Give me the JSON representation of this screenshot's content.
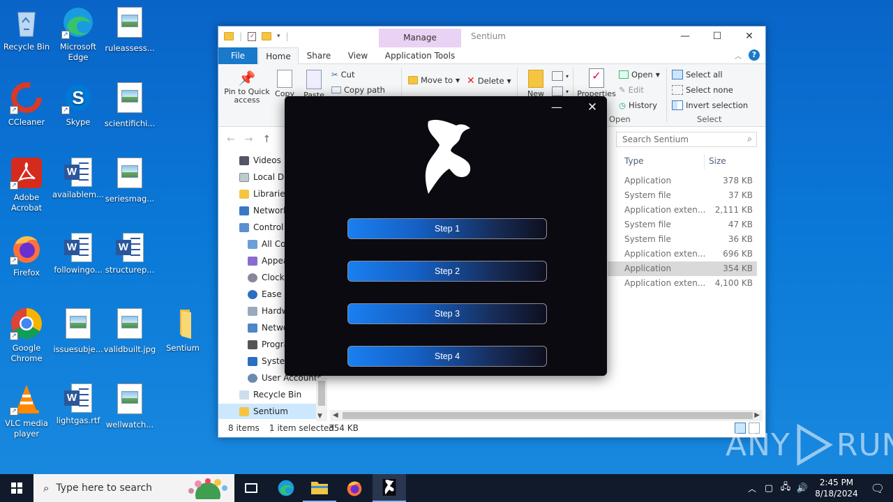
{
  "desktop": {
    "icons": [
      {
        "label": "Recycle Bin",
        "icon": "recycle-bin-icon"
      },
      {
        "label": "Microsoft Edge",
        "icon": "edge-icon"
      },
      {
        "label": "ruleassess...",
        "icon": "image-file-icon"
      },
      {
        "label": "CCleaner",
        "icon": "ccleaner-icon"
      },
      {
        "label": "Skype",
        "icon": "skype-icon"
      },
      {
        "label": "scientifichi...",
        "icon": "image-file-icon"
      },
      {
        "label": "Adobe Acrobat",
        "icon": "acrobat-icon"
      },
      {
        "label": "availablem...",
        "icon": "word-doc-icon"
      },
      {
        "label": "seriesmag...",
        "icon": "image-file-icon"
      },
      {
        "label": "Firefox",
        "icon": "firefox-icon"
      },
      {
        "label": "followingo...",
        "icon": "word-doc-icon"
      },
      {
        "label": "structurep...",
        "icon": "word-doc-icon"
      },
      {
        "label": "Google Chrome",
        "icon": "chrome-icon"
      },
      {
        "label": "issuesubje...",
        "icon": "image-file-icon"
      },
      {
        "label": "validbuilt.jpg",
        "icon": "image-file-icon"
      },
      {
        "label": "Sentium",
        "icon": "folder-icon"
      },
      {
        "label": "VLC media player",
        "icon": "vlc-icon"
      },
      {
        "label": "lightgas.rtf",
        "icon": "word-doc-icon"
      },
      {
        "label": "wellwatch...",
        "icon": "image-file-icon"
      }
    ]
  },
  "explorer": {
    "title": "Sentium",
    "manage_tab": "Manage",
    "tabs": {
      "file": "File",
      "home": "Home",
      "share": "Share",
      "view": "View",
      "app_tools": "Application Tools"
    },
    "ribbon": {
      "pin": "Pin to Quick access",
      "copy": "Copy",
      "paste": "Paste",
      "cut": "Cut",
      "copy_path": "Copy path",
      "move_to": "Move to",
      "delete": "Delete",
      "new": "New",
      "properties": "Properties",
      "open": "Open",
      "edit": "Edit",
      "history": "History",
      "open_group": "Open",
      "select_all": "Select all",
      "select_none": "Select none",
      "invert_selection": "Invert selection",
      "select_group": "Select"
    },
    "search_placeholder": "Search Sentium",
    "nav": [
      {
        "label": "Videos",
        "icon": "videos-icon"
      },
      {
        "label": "Local D",
        "icon": "drive-icon"
      },
      {
        "label": "Libraries",
        "icon": "libraries-icon"
      },
      {
        "label": "Network",
        "icon": "network-icon"
      },
      {
        "label": "Control",
        "icon": "control-panel-icon"
      },
      {
        "label": "All Co",
        "icon": "control-panel-icon"
      },
      {
        "label": "Appea",
        "icon": "appearance-icon"
      },
      {
        "label": "Clock",
        "icon": "clock-icon"
      },
      {
        "label": "Ease o",
        "icon": "ease-of-access-icon"
      },
      {
        "label": "Hardw",
        "icon": "hardware-icon"
      },
      {
        "label": "Netwo",
        "icon": "network-icon"
      },
      {
        "label": "Progra",
        "icon": "programs-icon"
      },
      {
        "label": "System",
        "icon": "system-icon"
      },
      {
        "label": "User Accounts",
        "icon": "user-accounts-icon"
      },
      {
        "label": "Recycle Bin",
        "icon": "recycle-bin-icon"
      },
      {
        "label": "Sentium",
        "icon": "folder-icon"
      }
    ],
    "columns": {
      "type": "Type",
      "size": "Size"
    },
    "files": [
      {
        "type": "Application",
        "size": "378 KB"
      },
      {
        "type": "System file",
        "size": "37 KB"
      },
      {
        "type": "Application exten...",
        "size": "2,111 KB"
      },
      {
        "type": "System file",
        "size": "47 KB"
      },
      {
        "type": "System file",
        "size": "36 KB"
      },
      {
        "type": "Application exten...",
        "size": "696 KB"
      },
      {
        "type": "Application",
        "size": "354 KB"
      },
      {
        "type": "Application exten...",
        "size": "4,100 KB"
      }
    ],
    "status": {
      "count": "8 items",
      "selected": "1 item selected",
      "size": "354 KB"
    }
  },
  "app": {
    "steps": [
      "Step 1",
      "Step 2",
      "Step 3",
      "Step 4"
    ]
  },
  "watermark": {
    "left": "ANY",
    "right": "RUN"
  },
  "taskbar": {
    "search_placeholder": "Type here to search",
    "time": "2:45 PM",
    "date": "8/18/2024"
  },
  "colors": {
    "accent": "#1979ca",
    "desktop": "#0a78d7",
    "app_bg": "#0b0a10",
    "manage_tab": "#e9d2f3"
  }
}
